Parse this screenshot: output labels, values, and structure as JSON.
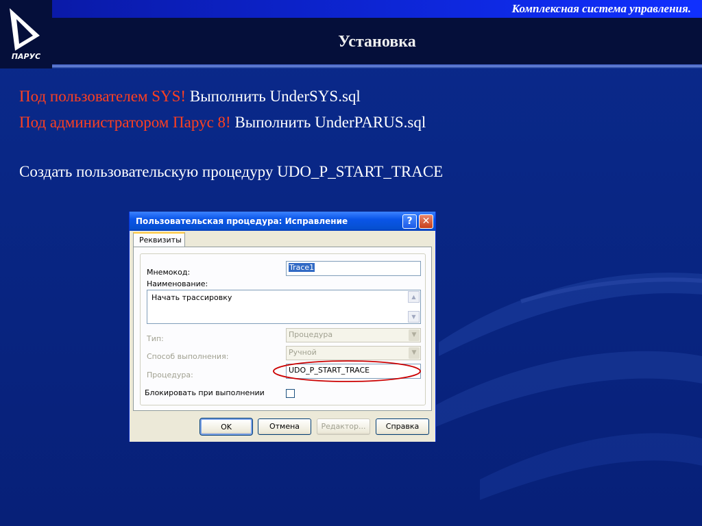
{
  "header": {
    "subtitle": "Комплексная система управления.",
    "title": "Установка",
    "logo_text": "ПАРУС"
  },
  "content": {
    "line1_red": "Под пользователем SYS!",
    "line1_text": " Выполнить UnderSYS.sql",
    "line2_red": "Под администратором Парус 8!",
    "line2_text": " Выполнить UnderPARUS.sql",
    "line3": "Создать пользовательскую процедуру UDO_P_START_TRACE"
  },
  "dialog": {
    "title": "Пользовательская процедура: Исправление",
    "tab": "Реквизиты",
    "mnemocode_label": "Мнемокод:",
    "mnemocode_value": "Trace1",
    "name_label": "Наименование:",
    "name_value": "Начать трассировку",
    "type_label": "Тип:",
    "type_value": "Процедура",
    "exec_label": "Способ выполнения:",
    "exec_value": "Ручной",
    "proc_label": "Процедура:",
    "proc_value": "UDO_P_START_TRACE",
    "block_label": "Блокировать при выполнении",
    "ok": "OK",
    "cancel": "Отмена",
    "editor": "Редактор...",
    "help": "Справка"
  },
  "colors": {
    "background": "#0a2a8c",
    "highlight": "#ff4020",
    "annotation": "#cc0000"
  }
}
